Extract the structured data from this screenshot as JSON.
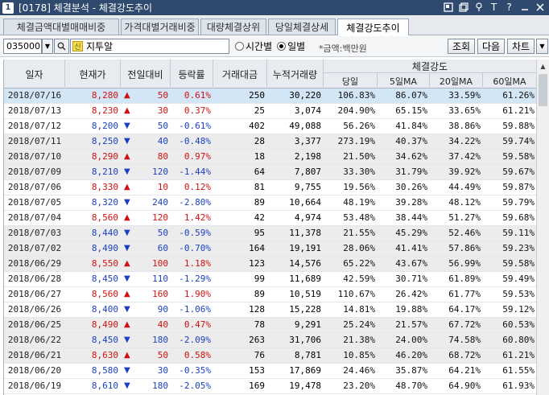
{
  "window": {
    "number": "1",
    "title": "[0178] 체결분석 - 체결강도추이"
  },
  "tabs": [
    {
      "label": "체결금액대별매매비중",
      "active": false
    },
    {
      "label": "가격대별거래비중",
      "active": false
    },
    {
      "label": "대량체결상위",
      "active": false
    },
    {
      "label": "당일체결상세",
      "active": false
    },
    {
      "label": "체결강도추이",
      "active": true
    }
  ],
  "toolbar": {
    "code": "035000",
    "badge": "신",
    "stock_name": "지투알",
    "radio_time": "시간별",
    "radio_day": "일별",
    "selected": "일별",
    "unit_note": "*금액:백만원",
    "btn_query": "조회",
    "btn_next": "다음",
    "btn_chart": "차트"
  },
  "grid": {
    "headers": {
      "date": "일자",
      "price": "현재가",
      "change": "전일대비",
      "rate": "등락률",
      "amount": "거래대금",
      "volume": "누적거래량",
      "strength": "체결강도",
      "today": "당일",
      "ma5": "5일MA",
      "ma20": "20일MA",
      "ma60": "60일MA"
    },
    "rows": [
      {
        "date": "2018/07/16",
        "price": "8,280",
        "dir": "up",
        "change": "50",
        "rate": "0.61%",
        "amount": "250",
        "volume": "30,220",
        "today": "106.83%",
        "ma5": "86.07%",
        "ma20": "33.59%",
        "ma60": "61.26%",
        "style": "hl"
      },
      {
        "date": "2018/07/13",
        "price": "8,230",
        "dir": "up",
        "change": "30",
        "rate": "0.37%",
        "amount": "25",
        "volume": "3,074",
        "today": "204.90%",
        "ma5": "65.15%",
        "ma20": "33.65%",
        "ma60": "61.21%",
        "style": ""
      },
      {
        "date": "2018/07/12",
        "price": "8,200",
        "dir": "down",
        "change": "50",
        "rate": "-0.61%",
        "amount": "402",
        "volume": "49,088",
        "today": "56.26%",
        "ma5": "41.84%",
        "ma20": "38.86%",
        "ma60": "59.88%",
        "style": ""
      },
      {
        "date": "2018/07/11",
        "price": "8,250",
        "dir": "down",
        "change": "40",
        "rate": "-0.48%",
        "amount": "28",
        "volume": "3,377",
        "today": "273.19%",
        "ma5": "40.37%",
        "ma20": "34.22%",
        "ma60": "59.74%",
        "style": "gray"
      },
      {
        "date": "2018/07/10",
        "price": "8,290",
        "dir": "up",
        "change": "80",
        "rate": "0.97%",
        "amount": "18",
        "volume": "2,198",
        "today": "21.50%",
        "ma5": "34.62%",
        "ma20": "37.42%",
        "ma60": "59.58%",
        "style": "gray"
      },
      {
        "date": "2018/07/09",
        "price": "8,210",
        "dir": "down",
        "change": "120",
        "rate": "-1.44%",
        "amount": "64",
        "volume": "7,807",
        "today": "33.30%",
        "ma5": "31.79%",
        "ma20": "39.92%",
        "ma60": "59.67%",
        "style": "gray"
      },
      {
        "date": "2018/07/06",
        "price": "8,330",
        "dir": "up",
        "change": "10",
        "rate": "0.12%",
        "amount": "81",
        "volume": "9,755",
        "today": "19.56%",
        "ma5": "30.26%",
        "ma20": "44.49%",
        "ma60": "59.87%",
        "style": ""
      },
      {
        "date": "2018/07/05",
        "price": "8,320",
        "dir": "down",
        "change": "240",
        "rate": "-2.80%",
        "amount": "89",
        "volume": "10,664",
        "today": "48.19%",
        "ma5": "39.28%",
        "ma20": "48.12%",
        "ma60": "59.79%",
        "style": ""
      },
      {
        "date": "2018/07/04",
        "price": "8,560",
        "dir": "up",
        "change": "120",
        "rate": "1.42%",
        "amount": "42",
        "volume": "4,974",
        "today": "53.48%",
        "ma5": "38.44%",
        "ma20": "51.27%",
        "ma60": "59.68%",
        "style": ""
      },
      {
        "date": "2018/07/03",
        "price": "8,440",
        "dir": "down",
        "change": "50",
        "rate": "-0.59%",
        "amount": "95",
        "volume": "11,378",
        "today": "21.55%",
        "ma5": "45.29%",
        "ma20": "52.46%",
        "ma60": "59.11%",
        "style": "gray"
      },
      {
        "date": "2018/07/02",
        "price": "8,490",
        "dir": "down",
        "change": "60",
        "rate": "-0.70%",
        "amount": "164",
        "volume": "19,191",
        "today": "28.06%",
        "ma5": "41.41%",
        "ma20": "57.86%",
        "ma60": "59.23%",
        "style": "gray"
      },
      {
        "date": "2018/06/29",
        "price": "8,550",
        "dir": "up",
        "change": "100",
        "rate": "1.18%",
        "amount": "123",
        "volume": "14,576",
        "today": "65.22%",
        "ma5": "43.67%",
        "ma20": "56.99%",
        "ma60": "59.58%",
        "style": "gray"
      },
      {
        "date": "2018/06/28",
        "price": "8,450",
        "dir": "down",
        "change": "110",
        "rate": "-1.29%",
        "amount": "99",
        "volume": "11,689",
        "today": "42.59%",
        "ma5": "30.71%",
        "ma20": "61.89%",
        "ma60": "59.49%",
        "style": ""
      },
      {
        "date": "2018/06/27",
        "price": "8,560",
        "dir": "up",
        "change": "160",
        "rate": "1.90%",
        "amount": "89",
        "volume": "10,519",
        "today": "110.67%",
        "ma5": "26.42%",
        "ma20": "61.77%",
        "ma60": "59.53%",
        "style": ""
      },
      {
        "date": "2018/06/26",
        "price": "8,400",
        "dir": "down",
        "change": "90",
        "rate": "-1.06%",
        "amount": "128",
        "volume": "15,228",
        "today": "14.81%",
        "ma5": "19.88%",
        "ma20": "64.17%",
        "ma60": "59.12%",
        "style": ""
      },
      {
        "date": "2018/06/25",
        "price": "8,490",
        "dir": "up",
        "change": "40",
        "rate": "0.47%",
        "amount": "78",
        "volume": "9,291",
        "today": "25.24%",
        "ma5": "21.57%",
        "ma20": "67.72%",
        "ma60": "60.53%",
        "style": "gray"
      },
      {
        "date": "2018/06/22",
        "price": "8,450",
        "dir": "down",
        "change": "180",
        "rate": "-2.09%",
        "amount": "263",
        "volume": "31,706",
        "today": "21.38%",
        "ma5": "24.00%",
        "ma20": "74.58%",
        "ma60": "60.80%",
        "style": "gray"
      },
      {
        "date": "2018/06/21",
        "price": "8,630",
        "dir": "up",
        "change": "50",
        "rate": "0.58%",
        "amount": "76",
        "volume": "8,781",
        "today": "10.85%",
        "ma5": "46.20%",
        "ma20": "68.72%",
        "ma60": "61.21%",
        "style": "gray"
      },
      {
        "date": "2018/06/20",
        "price": "8,580",
        "dir": "down",
        "change": "30",
        "rate": "-0.35%",
        "amount": "153",
        "volume": "17,869",
        "today": "24.46%",
        "ma5": "35.87%",
        "ma20": "64.21%",
        "ma60": "61.55%",
        "style": ""
      },
      {
        "date": "2018/06/19",
        "price": "8,610",
        "dir": "down",
        "change": "180",
        "rate": "-2.05%",
        "amount": "169",
        "volume": "19,478",
        "today": "23.20%",
        "ma5": "48.70%",
        "ma20": "64.90%",
        "ma60": "61.93%",
        "style": ""
      }
    ]
  },
  "colors": {
    "up": "#d01010",
    "down": "#1a3fc0",
    "title_bar": "#2f4a6e",
    "highlight_row": "#d3e6f6"
  }
}
